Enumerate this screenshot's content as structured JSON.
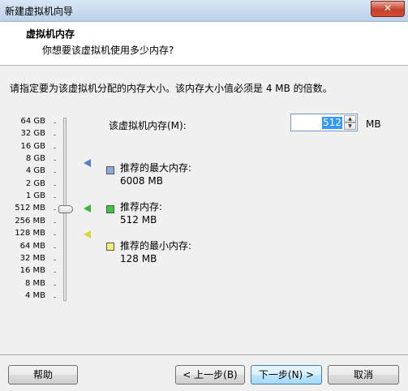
{
  "window": {
    "title": "新建虚拟机向导",
    "close_symbol": "✕"
  },
  "header": {
    "title": "虚拟机内存",
    "subtitle": "你想要该虚拟机使用多少内存?"
  },
  "instruction": "请指定要为该虚拟机分配的内存大小。该内存大小值必须是 4 MB 的倍数。",
  "slider": {
    "ticks": [
      "64 GB",
      "32 GB",
      "16 GB",
      "8 GB",
      "4 GB",
      "2 GB",
      "1 GB",
      "512 MB",
      "256 MB",
      "128 MB",
      "64 MB",
      "32 MB",
      "16 MB",
      "8 MB",
      "4 MB"
    ],
    "current": "512 MB"
  },
  "legend": {
    "max": {
      "label": "推荐的最大内存:",
      "value": "6008 MB",
      "color": "#5b7fc4"
    },
    "recommended": {
      "label": "推荐内存:",
      "value": "512 MB",
      "color": "#3cb33c"
    },
    "min": {
      "label": "推荐的最小内存:",
      "value": "128 MB",
      "color": "#d8d83a"
    }
  },
  "memory": {
    "label": "该虚拟机内存(M):",
    "value": "512",
    "unit": "MB"
  },
  "buttons": {
    "help": "帮助",
    "back": "< 上一步(B)",
    "next": "下一步(N) >",
    "cancel": "取消"
  }
}
